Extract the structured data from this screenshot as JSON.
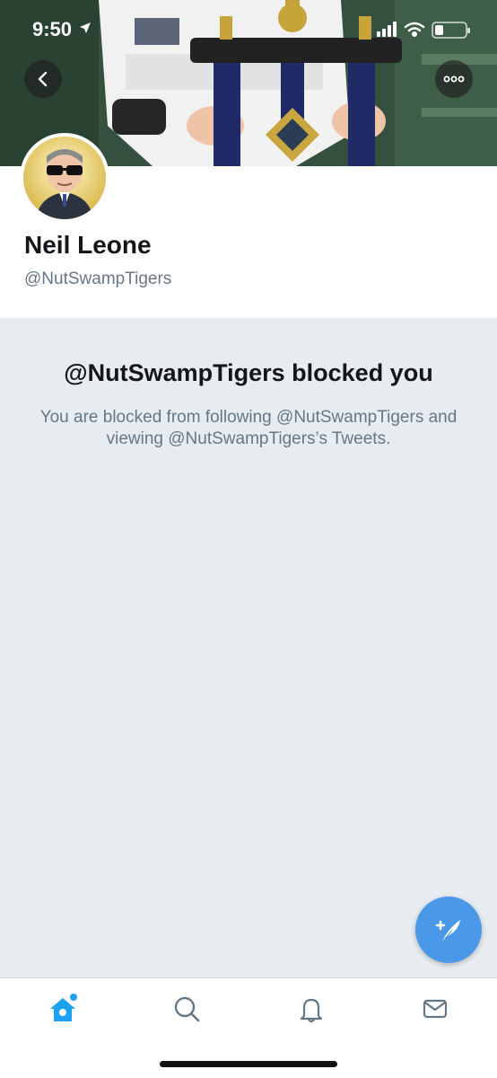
{
  "status_bar": {
    "time": "9:50",
    "icons": [
      "location-arrow-icon",
      "cellular-signal-icon",
      "wifi-icon",
      "battery-icon"
    ]
  },
  "header": {
    "back_icon": "chevron-left-icon",
    "more_icon": "ellipsis-icon"
  },
  "profile": {
    "name": "Neil Leone",
    "handle": "@NutSwampTigers"
  },
  "blocked": {
    "title": "@NutSwampTigers blocked you",
    "description": "You are blocked from following @NutSwampTigers and viewing @NutSwampTigers’s Tweets."
  },
  "fab": {
    "icon": "compose-tweet-icon"
  },
  "tabbar": {
    "tabs": [
      {
        "icon": "home-icon",
        "active": true
      },
      {
        "icon": "search-icon",
        "active": false
      },
      {
        "icon": "bell-icon",
        "active": false
      },
      {
        "icon": "mail-icon",
        "active": false
      }
    ]
  },
  "colors": {
    "accent": "#1da1f2",
    "fab": "#4a99e9",
    "background": "#e6ecf0",
    "muted_text": "#657786",
    "primary_text": "#14171a"
  }
}
